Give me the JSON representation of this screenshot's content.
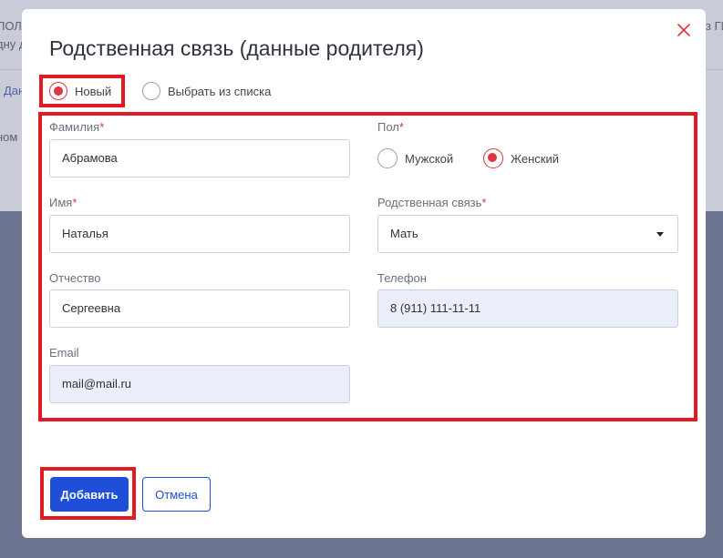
{
  "background": {
    "fragments": [
      "ПОЛЕ",
      "дну д",
      "Дан",
      "ном",
      "з ГИ"
    ]
  },
  "modal": {
    "title": "Родственная связь (данные родителя)",
    "close_icon": "close-icon",
    "mode_options": [
      {
        "label": "Новый",
        "checked": true
      },
      {
        "label": "Выбрать из списка",
        "checked": false
      }
    ],
    "fields": {
      "last_name": {
        "label": "Фамилия",
        "required": "*",
        "value": "Абрамова"
      },
      "first_name": {
        "label": "Имя",
        "required": "*",
        "value": "Наталья"
      },
      "patronymic": {
        "label": "Отчество",
        "value": "Сергеевна"
      },
      "email": {
        "label": "Email",
        "value": "mail@mail.ru"
      },
      "gender": {
        "label": "Пол",
        "required": "*",
        "options": [
          {
            "label": "Мужской",
            "checked": false
          },
          {
            "label": "Женский",
            "checked": true
          }
        ]
      },
      "relation": {
        "label": "Родственная связь",
        "required": "*",
        "value": "Мать"
      },
      "phone": {
        "label": "Телефон",
        "value": "8 (911) 111-11-11"
      }
    },
    "buttons": {
      "add": "Добавить",
      "cancel": "Отмена"
    }
  },
  "colors": {
    "accent": "#1f4fd8",
    "radio_checked": "#e2343f",
    "highlight": "#e01b24"
  }
}
